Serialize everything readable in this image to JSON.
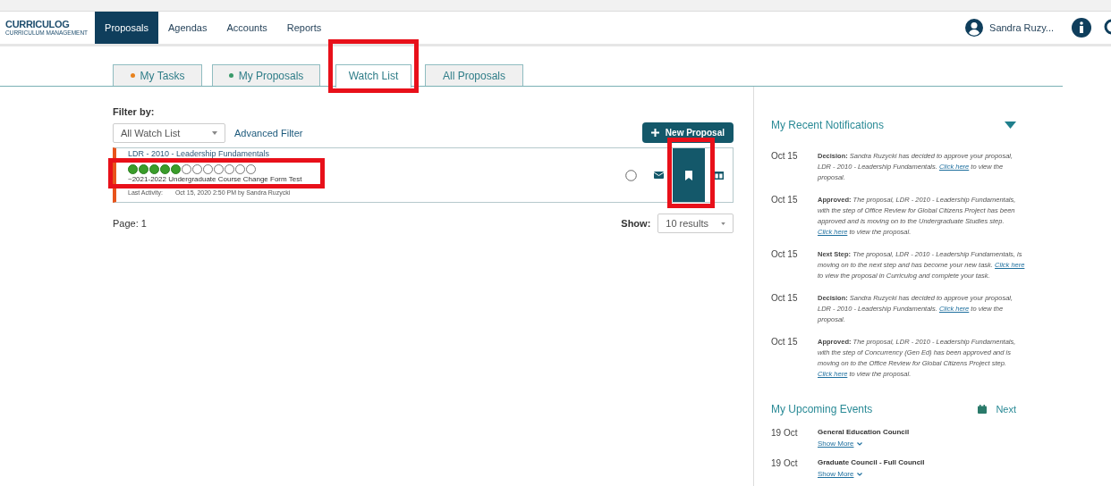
{
  "header": {
    "logo": {
      "name": "CURRICULOG",
      "tagline": "CURRICULUM MANAGEMENT"
    },
    "nav": [
      {
        "label": "Proposals",
        "selected": true
      },
      {
        "label": "Agendas",
        "selected": false
      },
      {
        "label": "Accounts",
        "selected": false
      },
      {
        "label": "Reports",
        "selected": false
      }
    ],
    "user": "Sandra Ruzy..."
  },
  "tabs": [
    {
      "label": "My Tasks",
      "color": "#e8821e",
      "selected": false,
      "highlighted": false
    },
    {
      "label": "My Proposals",
      "color": "#3a9a6a",
      "selected": false,
      "highlighted": false
    },
    {
      "label": "Watch List",
      "selected": true,
      "highlighted": true
    },
    {
      "label": "All Proposals",
      "selected": false,
      "highlighted": false
    }
  ],
  "filter": {
    "label": "Filter by:",
    "value": "All Watch List",
    "advanced": "Advanced Filter"
  },
  "new_proposal": "New Proposal",
  "proposals": [
    {
      "title": "LDR - 2010 - Leadership Fundamentals",
      "steps": [
        true,
        true,
        true,
        true,
        true,
        false,
        false,
        false,
        false,
        false,
        false,
        false
      ],
      "highlighted": true,
      "form": "~2021-2022 Undergraduate Course Change Form Test",
      "activity_label": "Last Activity:",
      "activity": "Oct 15, 2020 2:50 PM by Sandra Ruzycki",
      "watched": true,
      "watch_highlighted": true
    }
  ],
  "page": {
    "label": "Page:",
    "value": "1"
  },
  "show": {
    "label": "Show:",
    "value": "10 results"
  },
  "notifications": {
    "title": "My Recent Notifications",
    "expanded": true,
    "items": [
      {
        "date": "Oct 15",
        "label": "Decision:",
        "text": "Sandra Ruzycki has decided to approve your proposal, LDR - 2010 - Leadership Fundamentals.",
        "link": "Click here",
        "after": "to view the proposal."
      },
      {
        "date": "Oct 15",
        "label": "Approved:",
        "text": "The proposal, LDR - 2010 - Leadership Fundamentals, with the step of Office Review for Global Citizens Project has been approved and is moving on to the Undergraduate Studies step.",
        "link": "Click here",
        "after": "to view the proposal."
      },
      {
        "date": "Oct 15",
        "label": "Next Step:",
        "text": "The proposal, LDR - 2010 - Leadership Fundamentals, is moving on to the next step and has become your new task.",
        "link": "Click here",
        "after": "to view the proposal in Curriculog and complete your task."
      },
      {
        "date": "Oct 15",
        "label": "Decision:",
        "text": "Sandra Ruzycki has decided to approve your proposal, LDR - 2010 - Leadership Fundamentals.",
        "link": "Click here",
        "after": "to view the proposal."
      },
      {
        "date": "Oct 15",
        "label": "Approved:",
        "text": "The proposal, LDR - 2010 - Leadership Fundamentals, with the step of Concurrency (Gen Ed) has been approved and is moving on to the Office Review for Global Citizens Project step.",
        "link": "Click here",
        "after": "to view the proposal."
      }
    ]
  },
  "events": {
    "title": "My Upcoming Events",
    "next": "Next",
    "items": [
      {
        "date": "19 Oct",
        "name": "General Education Council",
        "more": "Show More"
      },
      {
        "date": "19 Oct",
        "name": "Graduate Council - Full Council",
        "more": "Show More"
      }
    ]
  }
}
